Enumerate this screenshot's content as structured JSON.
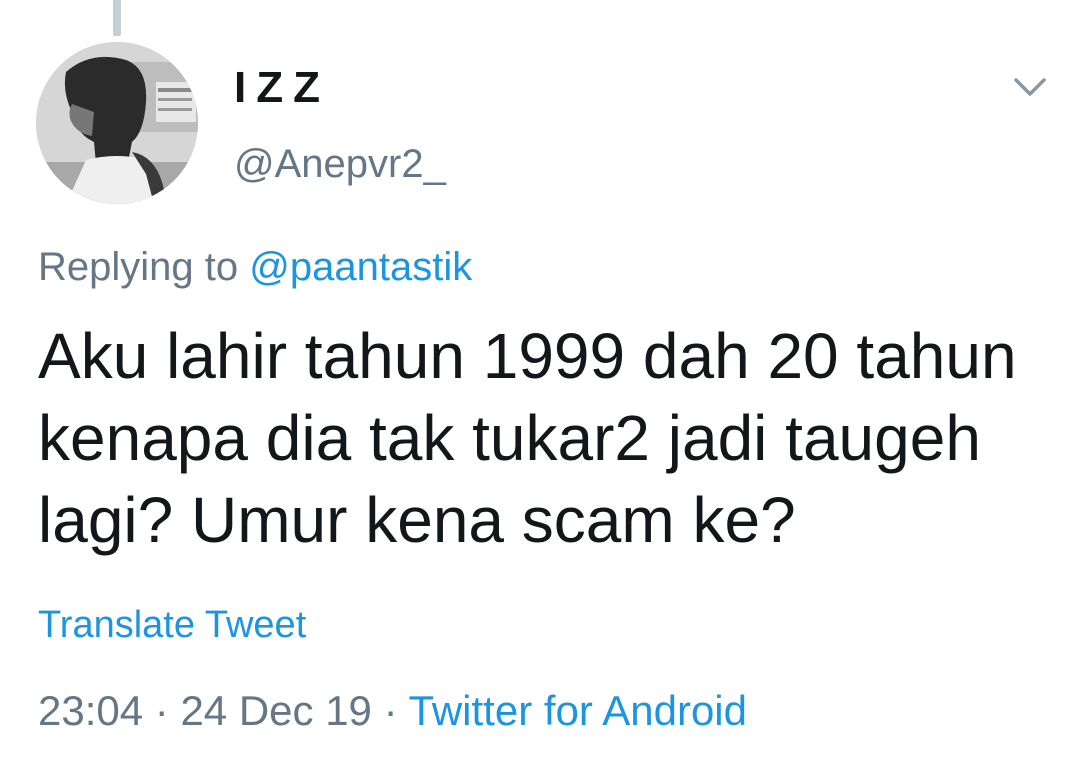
{
  "tweet": {
    "display_name": "IZZ",
    "handle": "@Anepvr2_",
    "replying_prefix": "Replying to",
    "replying_to": "@paantastik",
    "text": "Aku lahir tahun 1999 dah 20 tahun kenapa dia tak tukar2 jadi taugeh lagi? Umur kena scam ke?",
    "translate_label": "Translate Tweet",
    "time": "23:04",
    "date": "24 Dec 19",
    "source": "Twitter for Android",
    "separator": "·"
  },
  "icons": {
    "menu": "chevron-down-icon"
  },
  "colors": {
    "link": "#1b95e0",
    "secondary_text": "#657786",
    "primary_text": "#14171a",
    "thread_line": "#c4cfd6"
  }
}
